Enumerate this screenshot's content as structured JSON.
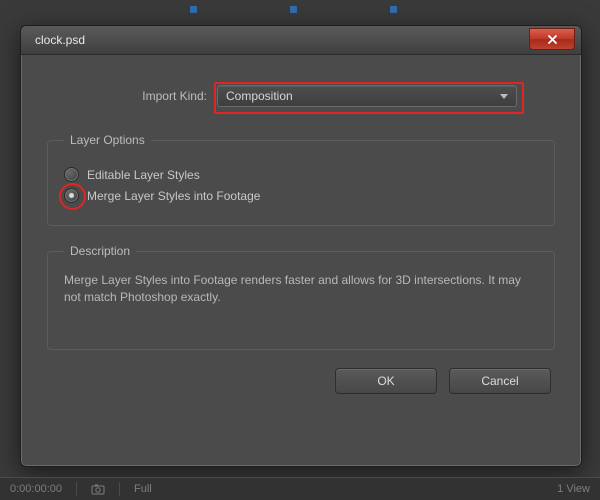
{
  "window": {
    "title": "clock.psd"
  },
  "import": {
    "label": "Import Kind:",
    "selected": "Composition"
  },
  "layerOptions": {
    "legend": "Layer Options",
    "opt1": "Editable Layer Styles",
    "opt2": "Merge Layer Styles into Footage",
    "selected": "opt2"
  },
  "description": {
    "legend": "Description",
    "text": "Merge Layer Styles into Footage renders faster and allows for 3D intersections. It may not match Photoshop exactly."
  },
  "buttons": {
    "ok": "OK",
    "cancel": "Cancel"
  },
  "statusbar": {
    "timecode": "0:00:00:00",
    "full": "Full",
    "view": "1 View"
  }
}
